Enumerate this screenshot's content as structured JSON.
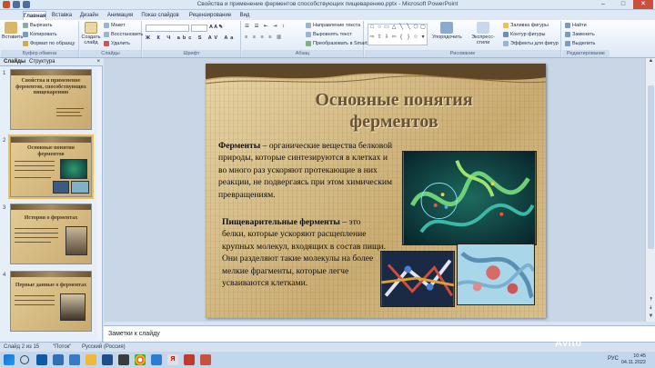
{
  "window": {
    "title": "Свойства и применение ферментов способствующих пищеварению.pptx - Microsoft PowerPoint"
  },
  "tabs": [
    "Главная",
    "Вставка",
    "Дизайн",
    "Анимация",
    "Показ слайдов",
    "Рецензирование",
    "Вид"
  ],
  "ribbon": {
    "clipboard": {
      "label": "Буфер обмена",
      "paste": "Вставить",
      "cut": "Вырезать",
      "copy": "Копировать",
      "format_painter": "Формат по образцу"
    },
    "slides": {
      "label": "Слайды",
      "create": "Создать слайд",
      "layout": "Макет",
      "reset": "Восстановить",
      "delete": "Удалить"
    },
    "font": {
      "label": "Шрифт"
    },
    "paragraph": {
      "label": "Абзац",
      "text_direction": "Направление текста",
      "align_text": "Выровнять текст",
      "smartart": "Преобразовать в SmartArt"
    },
    "drawing": {
      "label": "Рисование",
      "arrange": "Упорядочить",
      "quick_styles": "Экспресс-стили",
      "shape_fill": "Заливка фигуры",
      "shape_outline": "Контур фигуры",
      "shape_effects": "Эффекты для фигур"
    },
    "editing": {
      "label": "Редактирование",
      "find": "Найти",
      "replace": "Заменить",
      "select": "Выделить"
    }
  },
  "left_pane": {
    "tab_slides": "Слайды",
    "tab_outline": "Структура",
    "close": "×",
    "thumbs": [
      {
        "num": "1",
        "title": "Свойства и применение ферментов, способствующих пищеварению"
      },
      {
        "num": "2",
        "title": "Основные понятия ферментов"
      },
      {
        "num": "3",
        "title": "История о ферментах"
      },
      {
        "num": "4",
        "title": "Первые данные о ферментах"
      }
    ]
  },
  "slide": {
    "title_line1": "Основные понятия",
    "title_line2": "ферментов",
    "p1_term": "Ферменты",
    "p1_text": " – органические вещества белковой природы, которые синтезируются в клетках и во много раз ускоряют протекающие в них реакции, не подвергаясь при этом химическим превращениям.",
    "p2_term": "Пищеварительные ферменты",
    "p2_text": " – это белки, которые ускоряют расщепление крупных молекул, входящих в состав пищи. Они разделяют такие молекулы на более мелкие фрагменты, которые легче усваиваются клетками."
  },
  "notes": {
    "placeholder": "Заметки к слайду"
  },
  "status": {
    "slide_of": "Слайд 2 из 15",
    "theme": "\"Поток\"",
    "language": "Русский (Россия)"
  },
  "taskbar": {
    "lang": "РУС",
    "time": "10:45",
    "date": "04.11.2022"
  },
  "watermark": "Avito"
}
